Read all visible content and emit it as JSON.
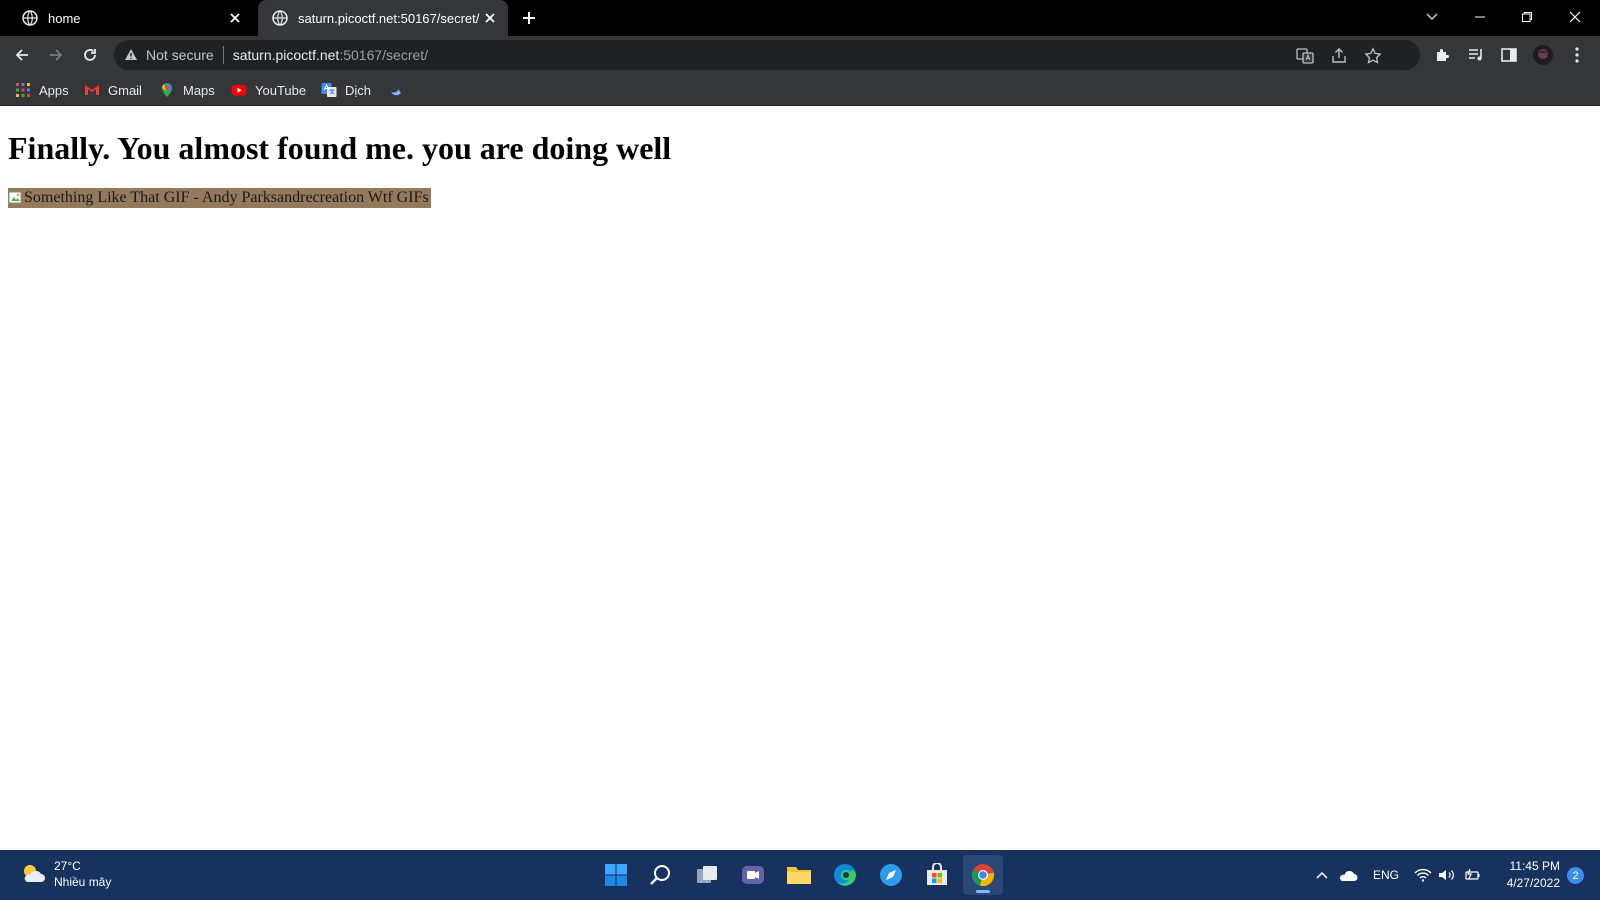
{
  "browser": {
    "tabs": [
      {
        "title": "home",
        "active": false
      },
      {
        "title": "saturn.picoctf.net:50167/secret/",
        "active": true
      }
    ],
    "address_bar": {
      "security_label": "Not secure",
      "url_host": "saturn.picoctf.net",
      "url_rest": ":50167/secret/"
    },
    "bookmarks": [
      {
        "label": "Apps",
        "icon": "apps-grid-icon"
      },
      {
        "label": "Gmail",
        "icon": "gmail-icon"
      },
      {
        "label": "Maps",
        "icon": "maps-icon"
      },
      {
        "label": "YouTube",
        "icon": "youtube-icon"
      },
      {
        "label": "Dịch",
        "icon": "translate-icon"
      }
    ]
  },
  "page": {
    "heading": "Finally. You almost found me. you are doing well",
    "image_alt": "Something Like That GIF - Andy Parksandrecreation Wtf GIFs"
  },
  "taskbar": {
    "weather": {
      "temp": "27°C",
      "condition": "Nhiều mây"
    },
    "language": "ENG",
    "clock": {
      "time": "11:45 PM",
      "date": "4/27/2022"
    },
    "notification_count": "2"
  },
  "colors": {
    "tab_strip": "#000000",
    "toolbar": "#35363a",
    "omnibox": "#202124",
    "taskbar": "#17325e",
    "broken_image_bg": "#937a5a"
  }
}
